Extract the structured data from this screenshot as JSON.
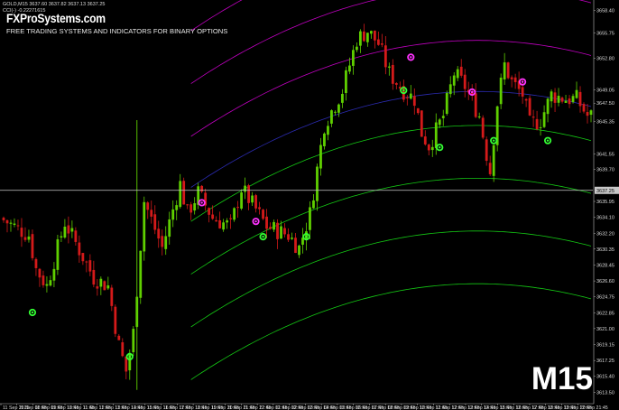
{
  "header": {
    "symbol_line": "GOLD,M15  3637.60 3637.82 3637.13 3637.25",
    "indicator_line": "CCI(-) -0.22271615",
    "brand": "FXProSystems.com",
    "tagline": "FREE TRADING SYSTEMS AND INDICATORS FOR BINARY OPTIONS",
    "timeframe": "M15"
  },
  "colors": {
    "background": "#000000",
    "bull_candle": "#5fcf00",
    "bear_candle": "#d41a1a",
    "upper_bands": "#c000c0",
    "middle_band": "#2b2bb0",
    "lower_bands": "#14c814",
    "sell_marker": "#ff33ff",
    "buy_marker": "#33ff33",
    "price_line": "#c8c8c8"
  },
  "chart_data": {
    "type": "candlestick",
    "symbol": "GOLD",
    "timeframe": "M15",
    "current_price": 3637.25,
    "y_ticks": [
      3658.4,
      3655.75,
      3652.8,
      3649.05,
      3647.5,
      3645.35,
      3641.55,
      3639.7,
      3637.25,
      3635.95,
      3634.1,
      3632.2,
      3630.35,
      3628.45,
      3626.6,
      3624.75,
      3622.85,
      3621.0,
      3619.15,
      3617.25,
      3615.4,
      3613.5
    ],
    "x_ticks": [
      "11 Sep 2025",
      "11 Sep 08:45",
      "11 Sep 09:45",
      "11 Sep 10:45",
      "11 Sep 11:45",
      "11 Sep 12:45",
      "11 Sep 13:45",
      "11 Sep 14:45",
      "11 Sep 15:45",
      "11 Sep 16:45",
      "11 Sep 17:45",
      "11 Sep 18:45",
      "11 Sep 19:45",
      "11 Sep 20:45",
      "11 Sep 21:45",
      "11 Sep 22:45",
      "12 Sep 01:45",
      "12 Sep 02:45",
      "12 Sep 03:45",
      "12 Sep 04:45",
      "12 Sep 05:45",
      "12 Sep 06:45",
      "12 Sep 07:45",
      "12 Sep 08:45",
      "12 Sep 09:45",
      "12 Sep 10:45",
      "12 Sep 11:45",
      "12 Sep 12:45",
      "12 Sep 13:45",
      "12 Sep 14:45",
      "12 Sep 15:45",
      "12 Sep 16:45",
      "12 Sep 17:45",
      "12 Sep 18:45",
      "12 Sep 19:45",
      "12 Sep 20:45",
      "12 Sep 21:45"
    ],
    "x_tick_every_bars": 4,
    "ylim": [
      3612.6,
      3659.2
    ],
    "bar_count": 164,
    "price_path": [
      [
        0,
        3634.0
      ],
      [
        8,
        3632.0
      ],
      [
        10,
        3628.0
      ],
      [
        13,
        3626.0
      ],
      [
        18,
        3633.5
      ],
      [
        26,
        3627.0
      ],
      [
        30,
        3626.0
      ],
      [
        33,
        3619.0
      ],
      [
        35,
        3616.0
      ],
      [
        37,
        3620.5
      ],
      [
        40,
        3636.0
      ],
      [
        45,
        3630.5
      ],
      [
        50,
        3638.0
      ],
      [
        52,
        3634.5
      ],
      [
        55,
        3637.0
      ],
      [
        59,
        3634.0
      ],
      [
        64,
        3633.0
      ],
      [
        67,
        3637.5
      ],
      [
        71,
        3635.0
      ],
      [
        74,
        3633.0
      ],
      [
        80,
        3632.0
      ],
      [
        83,
        3630.5
      ],
      [
        86,
        3634.5
      ],
      [
        90,
        3645.0
      ],
      [
        95,
        3649.0
      ],
      [
        99,
        3655.0
      ],
      [
        102,
        3656.0
      ],
      [
        105,
        3654.5
      ],
      [
        108,
        3651.0
      ],
      [
        112,
        3649.0
      ],
      [
        115,
        3648.0
      ],
      [
        117,
        3644.0
      ],
      [
        119,
        3642.5
      ],
      [
        123,
        3646.0
      ],
      [
        126,
        3651.0
      ],
      [
        129,
        3649.5
      ],
      [
        133,
        3646.0
      ],
      [
        135,
        3641.5
      ],
      [
        136,
        3639.5
      ],
      [
        138,
        3647.5
      ],
      [
        140,
        3652.0
      ],
      [
        142,
        3650.0
      ],
      [
        145,
        3648.5
      ],
      [
        147,
        3645.0
      ],
      [
        150,
        3645.5
      ],
      [
        153,
        3648.5
      ],
      [
        157,
        3648.0
      ],
      [
        160,
        3648.0
      ],
      [
        163,
        3646.0
      ]
    ],
    "bands": {
      "upper": [
        {
          "h": 0.0
        },
        {
          "h": 6.2
        },
        {
          "h": 12.4
        }
      ],
      "middle": {
        "h": 0.0
      },
      "lower": [
        {
          "h": 0.0
        },
        {
          "h": -6.2
        },
        {
          "h": -12.4
        },
        {
          "h": -18.6
        }
      ]
    },
    "markers": [
      {
        "type": "sell",
        "bar": 55,
        "price": 3635.8
      },
      {
        "type": "sell",
        "bar": 70,
        "price": 3633.6
      },
      {
        "type": "sell",
        "bar": 113,
        "price": 3652.9
      },
      {
        "type": "sell",
        "bar": 130,
        "price": 3648.8
      },
      {
        "type": "sell",
        "bar": 144,
        "price": 3650.0
      },
      {
        "type": "buy",
        "bar": 8,
        "price": 3622.9
      },
      {
        "type": "buy",
        "bar": 35,
        "price": 3617.7
      },
      {
        "type": "buy",
        "bar": 72,
        "price": 3631.8
      },
      {
        "type": "buy",
        "bar": 84,
        "price": 3631.8
      },
      {
        "type": "buy",
        "bar": 111,
        "price": 3649.0
      },
      {
        "type": "buy",
        "bar": 121,
        "price": 3642.3
      },
      {
        "type": "buy",
        "bar": 136,
        "price": 3643.1
      },
      {
        "type": "buy",
        "bar": 151,
        "price": 3643.1
      }
    ]
  }
}
